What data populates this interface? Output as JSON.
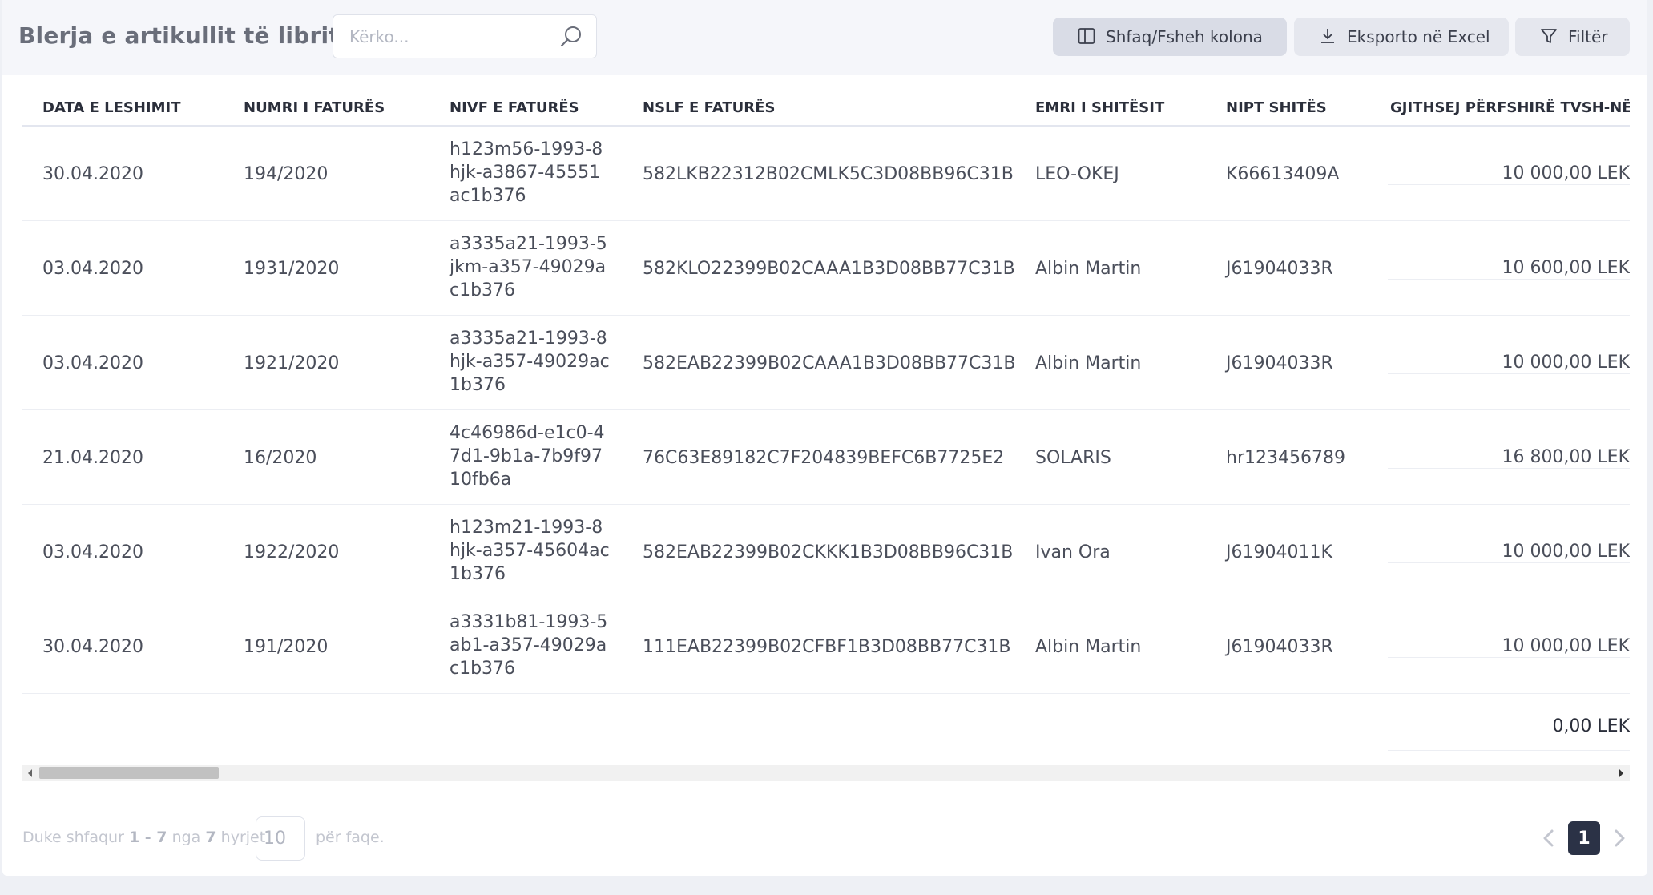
{
  "header": {
    "title": "Blerja e artikullit të librit",
    "search_placeholder": "Kërko...",
    "buttons": {
      "columns_label": "Shfaq/Fsheh kolona",
      "export_label": "Eksporto në Excel",
      "filter_label": "Filtër"
    }
  },
  "table": {
    "columns": [
      "DATA E LESHIMIT",
      "NUMRI I FATURËS",
      "NIVF E FATURËS",
      "NSLF E FATURËS",
      "EMRI I SHITËSIT",
      "NIPT SHITËS",
      "GJITHSEJ PËRFSHIRË TVSH-NË"
    ],
    "rows": [
      {
        "date": "30.04.2020",
        "invoice_no": "194/2020",
        "nivf": "h123m56-1993-8hjk-a3867-45551ac1b376",
        "nslf": "582LKB22312B02CMLK5C3D08BB96C31B",
        "seller": "LEO-OKEJ",
        "nipt": "K66613409A",
        "total": "10 000,00 LEK"
      },
      {
        "date": "03.04.2020",
        "invoice_no": "1931/2020",
        "nivf": "a3335a21-1993-5jkm-a357-49029ac1b376",
        "nslf": "582KLO22399B02CAAA1B3D08BB77C31B",
        "seller": "Albin Martin",
        "nipt": "J61904033R",
        "total": "10 600,00 LEK"
      },
      {
        "date": "03.04.2020",
        "invoice_no": "1921/2020",
        "nivf": "a3335a21-1993-8hjk-a357-49029ac1b376",
        "nslf": "582EAB22399B02CAAA1B3D08BB77C31B",
        "seller": "Albin Martin",
        "nipt": "J61904033R",
        "total": "10 000,00 LEK"
      },
      {
        "date": "21.04.2020",
        "invoice_no": "16/2020",
        "nivf": "4c46986d-e1c0-47d1-9b1a-7b9f9710fb6a",
        "nslf": "76C63E89182C7F204839BEFC6B7725E2",
        "seller": "SOLARIS",
        "nipt": "hr123456789",
        "total": "16 800,00 LEK"
      },
      {
        "date": "03.04.2020",
        "invoice_no": "1922/2020",
        "nivf": "h123m21-1993-8hjk-a357-45604ac1b376",
        "nslf": "582EAB22399B02CKKK1B3D08BB96C31B",
        "seller": "Ivan Ora",
        "nipt": "J61904011K",
        "total": "10 000,00 LEK"
      },
      {
        "date": "30.04.2020",
        "invoice_no": "191/2020",
        "nivf": "a3331b81-1993-5ab1-a357-49029ac1b376",
        "nslf": "111EAB22399B02CFBF1B3D08BB77C31B",
        "seller": "Albin Martin",
        "nipt": "J61904033R",
        "total": "10 000,00 LEK"
      }
    ],
    "sum_total": "0,00 LEK"
  },
  "footer": {
    "showing_prefix": "Duke shfaqur",
    "range": "1 - 7",
    "of_word": "nga",
    "count": "7",
    "entries_word": "hyrjet",
    "per_page_value": "10",
    "per_page_suffix": "për faqe.",
    "current_page": "1"
  }
}
